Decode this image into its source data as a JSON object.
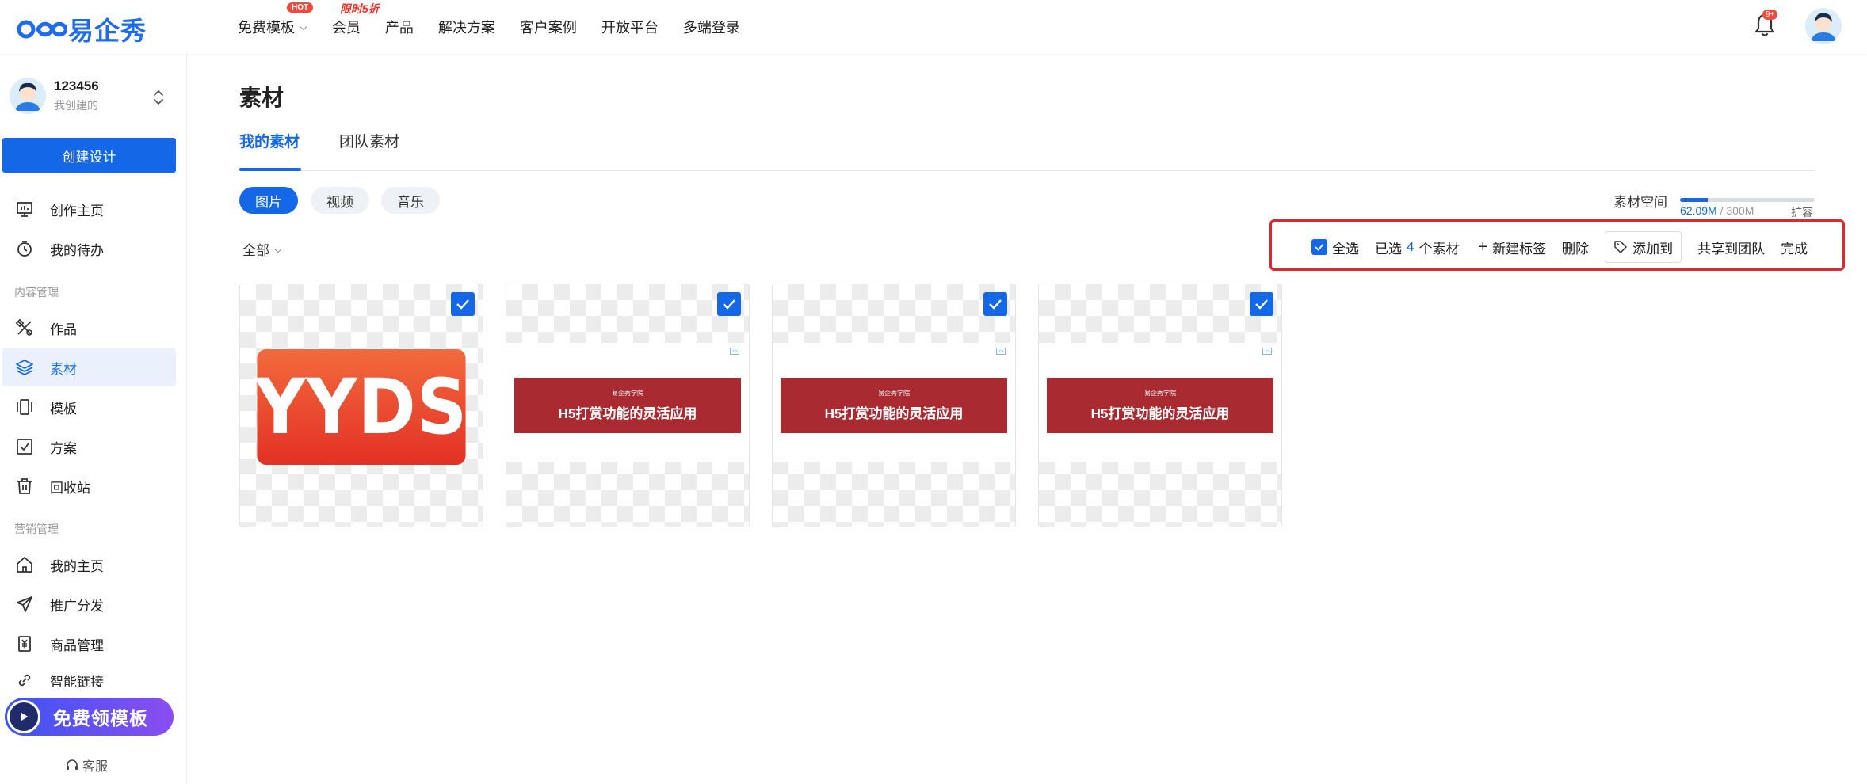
{
  "brand": {
    "name": "易企秀"
  },
  "nav": {
    "items": [
      {
        "label": "免费模板",
        "has_dropdown": true,
        "badge": "HOT"
      },
      {
        "label": "会员",
        "badge": "限时5折"
      },
      {
        "label": "产品"
      },
      {
        "label": "解决方案"
      },
      {
        "label": "客户案例"
      },
      {
        "label": "开放平台"
      },
      {
        "label": "多端登录"
      }
    ],
    "notification_count": "9+"
  },
  "sidebar": {
    "user_name": "123456",
    "user_sub": "我创建的",
    "create_button": "创建设计",
    "items_top": [
      {
        "label": "创作主页",
        "icon": "dashboard-icon"
      },
      {
        "label": "我的待办",
        "icon": "timer-icon"
      }
    ],
    "section_content": "内容管理",
    "items_content": [
      {
        "label": "作品",
        "icon": "tools-icon"
      },
      {
        "label": "素材",
        "icon": "layers-icon",
        "active": true
      },
      {
        "label": "模板",
        "icon": "template-icon"
      },
      {
        "label": "方案",
        "icon": "checklist-icon"
      },
      {
        "label": "回收站",
        "icon": "trash-icon"
      }
    ],
    "section_marketing": "营销管理",
    "items_marketing": [
      {
        "label": "我的主页",
        "icon": "home-icon"
      },
      {
        "label": "推广分发",
        "icon": "send-icon"
      },
      {
        "label": "商品管理",
        "icon": "product-icon"
      },
      {
        "label": "智能链接",
        "icon": "link-icon"
      }
    ],
    "promo": "免费领模板",
    "service": "客服"
  },
  "main": {
    "title": "素材",
    "tabs": [
      "我的素材",
      "团队素材"
    ],
    "chips": [
      "图片",
      "视频",
      "音乐"
    ],
    "storage": {
      "label": "素材空间",
      "used": "62.09M",
      "total": "300M",
      "fraction": 0.207,
      "expand": "扩容"
    },
    "filter": "全部",
    "actions": {
      "select_all": "全选",
      "selected_prefix": "已选",
      "selected_count": "4",
      "selected_suffix": "个素材",
      "new_tag": "新建标签",
      "delete": "删除",
      "add_to": "添加到",
      "share": "共享到团队",
      "done": "完成"
    },
    "cards": [
      {
        "type": "image",
        "text": "YYDS",
        "checked": true
      },
      {
        "type": "slide",
        "subtitle": "易企秀学院",
        "title": "H5打赏功能的灵活应用",
        "checked": true
      },
      {
        "type": "slide",
        "subtitle": "易企秀学院",
        "title": "H5打赏功能的灵活应用",
        "checked": true
      },
      {
        "type": "slide",
        "subtitle": "易企秀学院",
        "title": "H5打赏功能的灵活应用",
        "checked": true
      }
    ]
  },
  "colors": {
    "accent": "#1467e6",
    "highlight_box": "#e2262e",
    "slide_band": "#a92b31"
  }
}
